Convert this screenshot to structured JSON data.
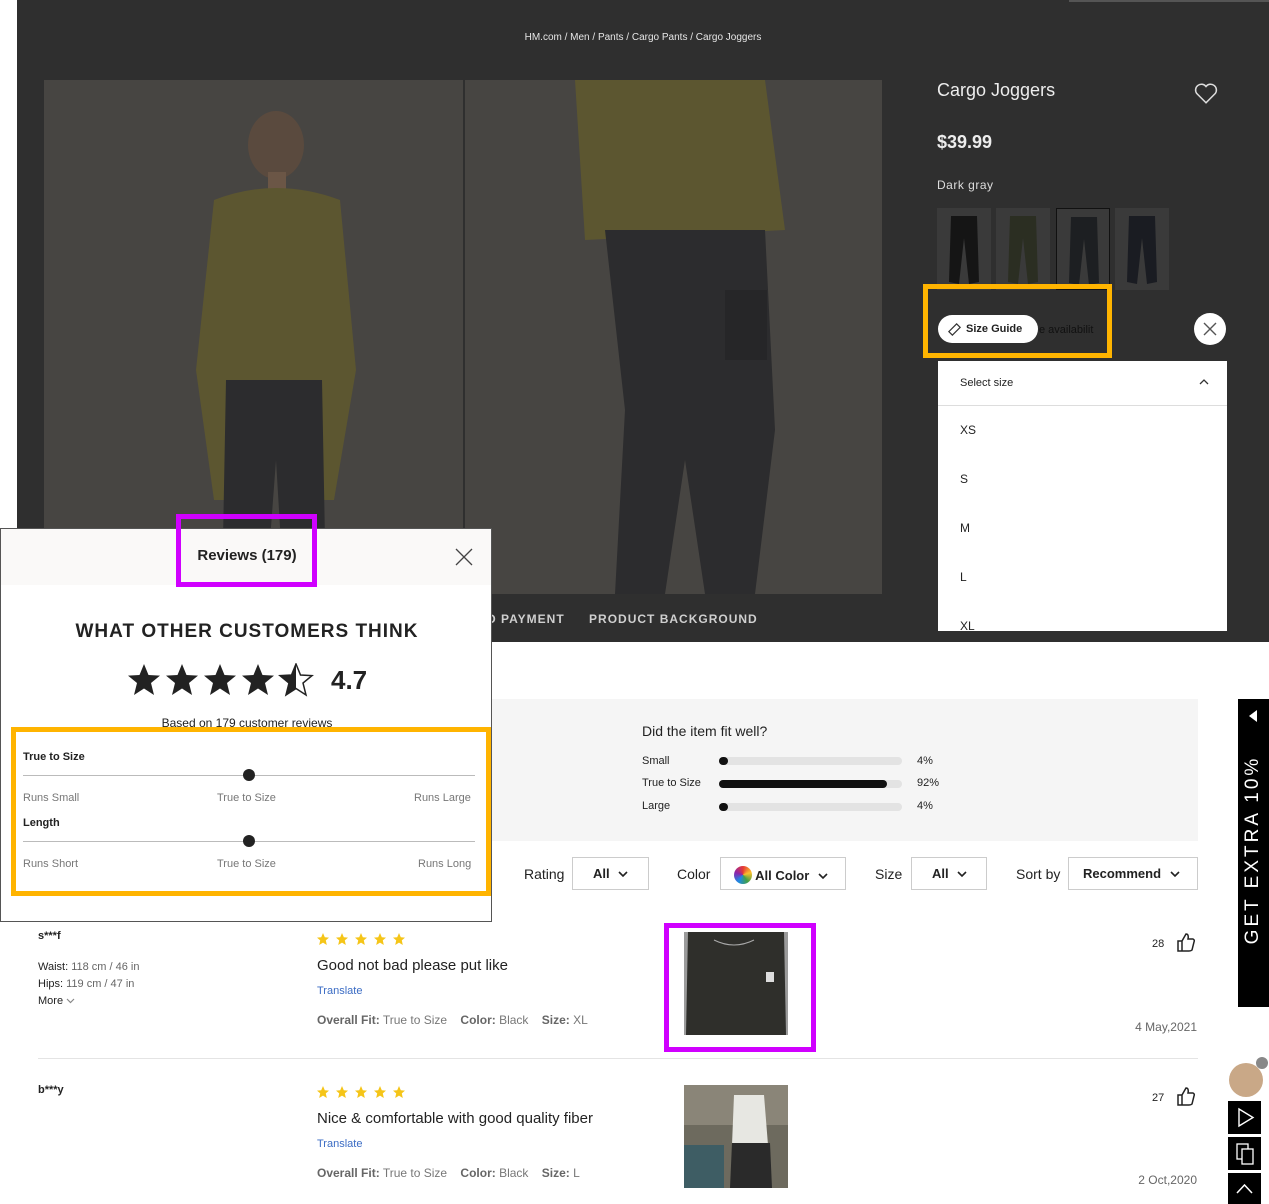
{
  "breadcrumb": "HM.com / Men / Pants / Cargo Pants / Cargo Joggers",
  "product": {
    "title": "Cargo Joggers",
    "price": "$39.99",
    "color_name": "Dark gray",
    "size_guide_label": "Size Guide",
    "availability_text": "e availabilit",
    "size_select": {
      "placeholder": "Select size",
      "options": [
        "XS",
        "S",
        "M",
        "L",
        "XL"
      ]
    },
    "tabs": [
      "D PAYMENT",
      "PRODUCT BACKGROUND"
    ]
  },
  "reviews_panel": {
    "title": "Reviews (179)",
    "heading": "WHAT OTHER CUSTOMERS THINK",
    "rating": "4.7",
    "rating_value": 4.7,
    "based_on": "Based on 179 customer reviews",
    "fit_scales": [
      {
        "label": "True to Size",
        "left": "Runs Small",
        "mid": "True to Size",
        "right": "Runs Large",
        "position": 0.5
      },
      {
        "label": "Length",
        "left": "Runs Short",
        "mid": "True to Size",
        "right": "Runs Long",
        "position": 0.5
      }
    ]
  },
  "fit_summary": {
    "title": "Did the item fit well?",
    "rows": [
      {
        "label": "Small",
        "pct": "4%",
        "value": 0.04
      },
      {
        "label": "True to Size",
        "pct": "92%",
        "value": 0.92
      },
      {
        "label": "Large",
        "pct": "4%",
        "value": 0.04
      }
    ]
  },
  "filters": {
    "rating_label": "Rating",
    "rating_value": "All",
    "color_label": "Color",
    "color_value": "All Color",
    "size_label": "Size",
    "size_value": "All",
    "sort_label": "Sort by",
    "sort_value": "Recommend"
  },
  "reviews": [
    {
      "user": "s***f",
      "waist": "118 cm / 46 in",
      "hips": "119 cm / 47 in",
      "more": "More",
      "text": "Good not bad please put like",
      "translate": "Translate",
      "fit": "True to Size",
      "color": "Black",
      "size": "XL",
      "likes": "28",
      "date": "4 May,2021"
    },
    {
      "user": "b***y",
      "text": "Nice & comfortable with good quality fiber",
      "translate": "Translate",
      "fit": "True to Size",
      "color": "Black",
      "size": "L",
      "likes": "27",
      "date": "2 Oct,2020"
    }
  ],
  "labels": {
    "waist": "Waist:",
    "hips": "Hips:",
    "overall_fit": "Overall Fit:",
    "color": "Color:",
    "size": "Size:"
  },
  "promo": "GET EXTRA 10%",
  "colors": {
    "accent_orange": "#ffb400",
    "accent_magenta": "#d000ff",
    "star_yellow": "#f5c518",
    "link_blue": "#3b6cc4",
    "promo_bg": "#000000"
  }
}
